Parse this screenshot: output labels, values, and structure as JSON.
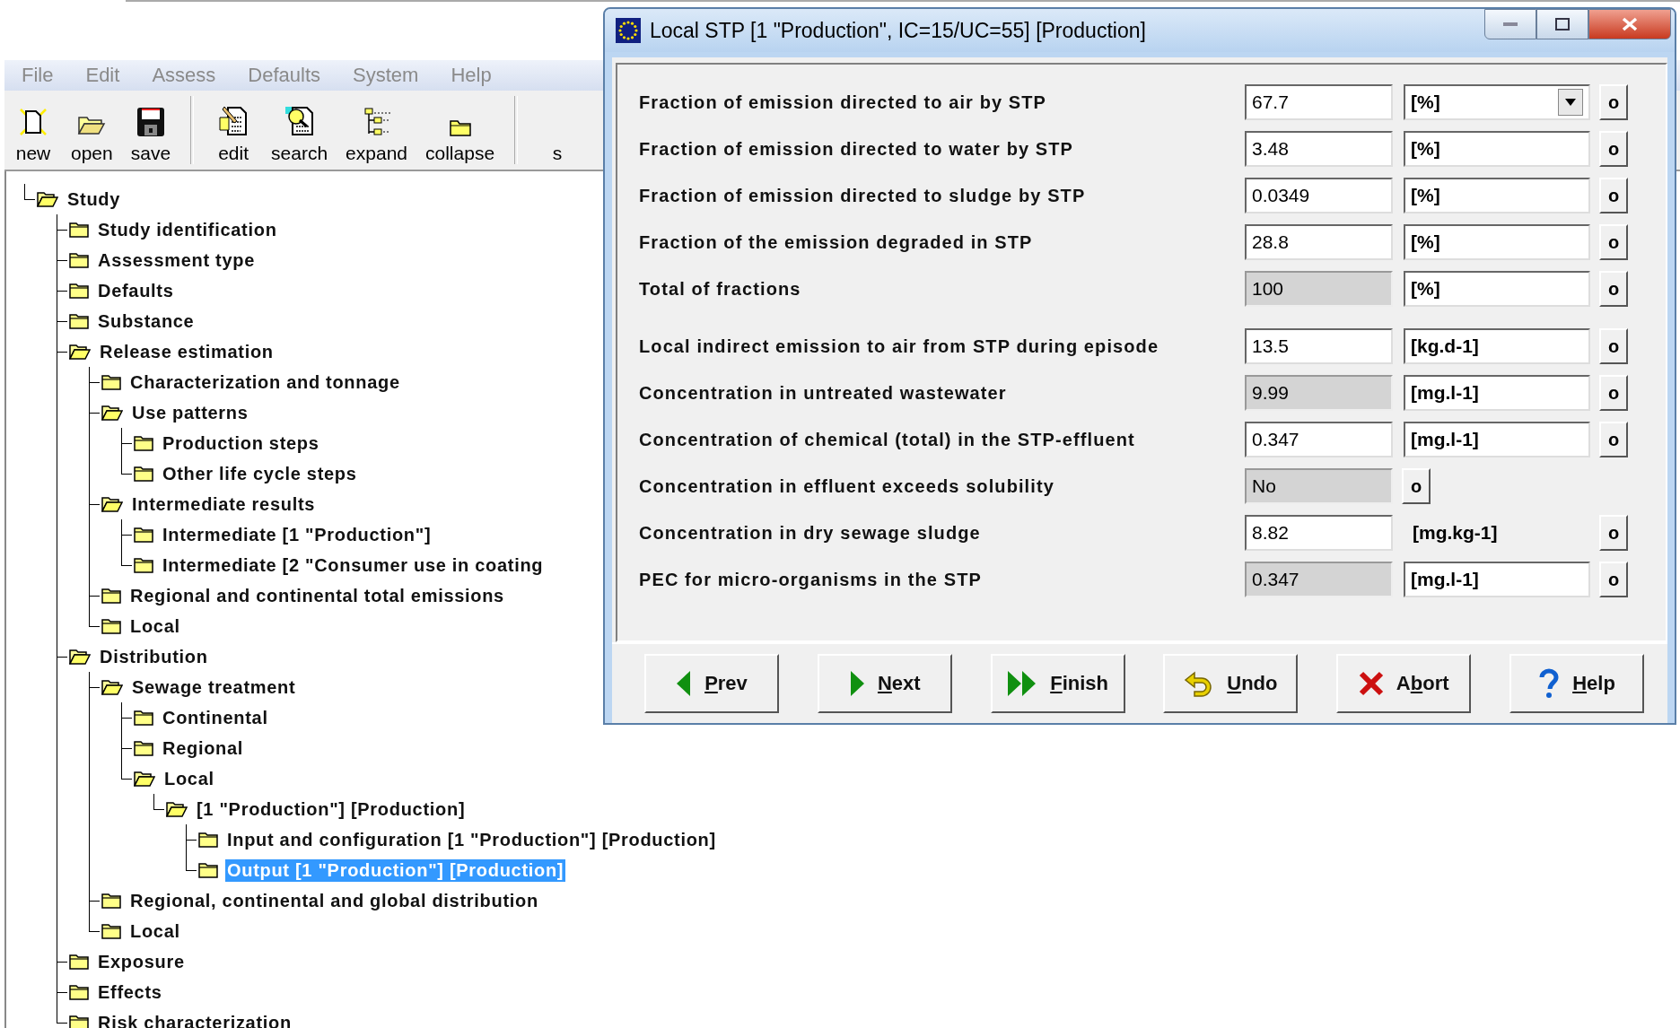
{
  "menu": [
    "File",
    "Edit",
    "Assess",
    "Defaults",
    "System",
    "Help"
  ],
  "toolbar": [
    {
      "label": "new",
      "kind": "new"
    },
    {
      "label": "open",
      "kind": "open"
    },
    {
      "label": "save",
      "kind": "save"
    },
    {
      "label": "edit",
      "kind": "edit",
      "separator_before": true
    },
    {
      "label": "search",
      "kind": "search"
    },
    {
      "label": "expand",
      "kind": "expand"
    },
    {
      "label": "collapse",
      "kind": "collapse"
    },
    {
      "label": "s",
      "kind": "partial",
      "separator_before": true
    }
  ],
  "tree": [
    {
      "label": "Study",
      "expanded": true,
      "selected": false,
      "children": [
        {
          "label": "Study identification",
          "expanded": false,
          "selected": false
        },
        {
          "label": "Assessment type",
          "expanded": false,
          "selected": false
        },
        {
          "label": "Defaults",
          "expanded": false,
          "selected": false
        },
        {
          "label": "Substance",
          "expanded": false,
          "selected": false
        },
        {
          "label": "Release estimation",
          "expanded": true,
          "selected": false,
          "children": [
            {
              "label": "Characterization and tonnage",
              "expanded": false,
              "selected": false
            },
            {
              "label": "Use patterns",
              "expanded": true,
              "selected": false,
              "children": [
                {
                  "label": "Production steps",
                  "expanded": false,
                  "selected": false
                },
                {
                  "label": "Other life cycle steps",
                  "expanded": false,
                  "selected": false
                }
              ]
            },
            {
              "label": "Intermediate results",
              "expanded": true,
              "selected": false,
              "children": [
                {
                  "label": "Intermediate [1 \"Production\"]",
                  "expanded": false,
                  "selected": false
                },
                {
                  "label": "Intermediate [2 \"Consumer use in coating",
                  "expanded": false,
                  "selected": false
                }
              ]
            },
            {
              "label": "Regional and continental total emissions",
              "expanded": false,
              "selected": false
            },
            {
              "label": "Local",
              "expanded": false,
              "selected": false
            }
          ]
        },
        {
          "label": "Distribution",
          "expanded": true,
          "selected": false,
          "children": [
            {
              "label": "Sewage treatment",
              "expanded": true,
              "selected": false,
              "children": [
                {
                  "label": "Continental",
                  "expanded": false,
                  "selected": false
                },
                {
                  "label": "Regional",
                  "expanded": false,
                  "selected": false
                },
                {
                  "label": "Local",
                  "expanded": true,
                  "selected": false,
                  "children": [
                    {
                      "label": "[1 \"Production\"] [Production]",
                      "expanded": true,
                      "selected": false,
                      "children": [
                        {
                          "label": "Input and configuration [1 \"Production\"] [Production]",
                          "expanded": false,
                          "selected": false
                        },
                        {
                          "label": "Output [1 \"Production\"] [Production]",
                          "expanded": false,
                          "selected": true
                        }
                      ]
                    }
                  ]
                }
              ]
            },
            {
              "label": "Regional, continental and global distribution",
              "expanded": false,
              "selected": false
            },
            {
              "label": "Local",
              "expanded": false,
              "selected": false
            }
          ]
        },
        {
          "label": "Exposure",
          "expanded": false,
          "selected": false
        },
        {
          "label": "Effects",
          "expanded": false,
          "selected": false
        },
        {
          "label": "Risk characterization",
          "expanded": false,
          "selected": false
        }
      ]
    }
  ],
  "dialog": {
    "title": "Local STP [1 \"Production\", IC=15/UC=55] [Production]",
    "groups": [
      [
        {
          "label": "Fraction of emission directed to air by STP",
          "value": "67.7",
          "readonly": false,
          "unit": {
            "text": "[%]",
            "kind": "dropdown"
          },
          "button": "o"
        },
        {
          "label": "Fraction of emission directed to water by STP",
          "value": "3.48",
          "readonly": false,
          "unit": {
            "text": "[%]",
            "kind": "field"
          },
          "button": "o"
        },
        {
          "label": "Fraction of emission directed to sludge by STP",
          "value": "0.0349",
          "readonly": false,
          "unit": {
            "text": "[%]",
            "kind": "field"
          },
          "button": "o"
        },
        {
          "label": "Fraction of the emission degraded in STP",
          "value": "28.8",
          "readonly": false,
          "unit": {
            "text": "[%]",
            "kind": "field"
          },
          "button": "o"
        },
        {
          "label": "Total of fractions",
          "value": "100",
          "readonly": true,
          "unit": {
            "text": "[%]",
            "kind": "field"
          },
          "button": "o"
        }
      ],
      [
        {
          "label": "Local indirect emission to air from STP during episode",
          "value": "13.5",
          "readonly": false,
          "unit": {
            "text": "[kg.d-1]",
            "kind": "field"
          },
          "button": "o"
        },
        {
          "label": "Concentration in untreated wastewater",
          "value": "9.99",
          "readonly": true,
          "unit": {
            "text": "[mg.l-1]",
            "kind": "field"
          },
          "button": "o"
        },
        {
          "label": "Concentration of chemical (total) in the STP-effluent",
          "value": "0.347",
          "readonly": false,
          "unit": {
            "text": "[mg.l-1]",
            "kind": "field"
          },
          "button": "o"
        },
        {
          "label": "Concentration in effluent exceeds solubility",
          "value": "No",
          "readonly": true,
          "button": "o"
        },
        {
          "label": "Concentration in dry sewage sludge",
          "value": "8.82",
          "readonly": false,
          "unit": {
            "text": "[mg.kg-1]",
            "kind": "text"
          },
          "button": "o"
        },
        {
          "label": "PEC for micro-organisms in the STP",
          "value": "0.347",
          "readonly": true,
          "unit": {
            "text": "[mg.l-1]",
            "kind": "field"
          },
          "button": "o"
        }
      ]
    ],
    "buttons": [
      {
        "kind": "prev",
        "accel": "P",
        "after": "rev"
      },
      {
        "kind": "next",
        "accel": "N",
        "after": "ext"
      },
      {
        "kind": "finish",
        "accel": "F",
        "after": "inish"
      },
      {
        "kind": "undo",
        "accel": "U",
        "after": "ndo"
      },
      {
        "kind": "abort",
        "before": "A",
        "accel": "b",
        "after": "ort"
      },
      {
        "kind": "help",
        "accel": "H",
        "after": "elp"
      }
    ]
  }
}
